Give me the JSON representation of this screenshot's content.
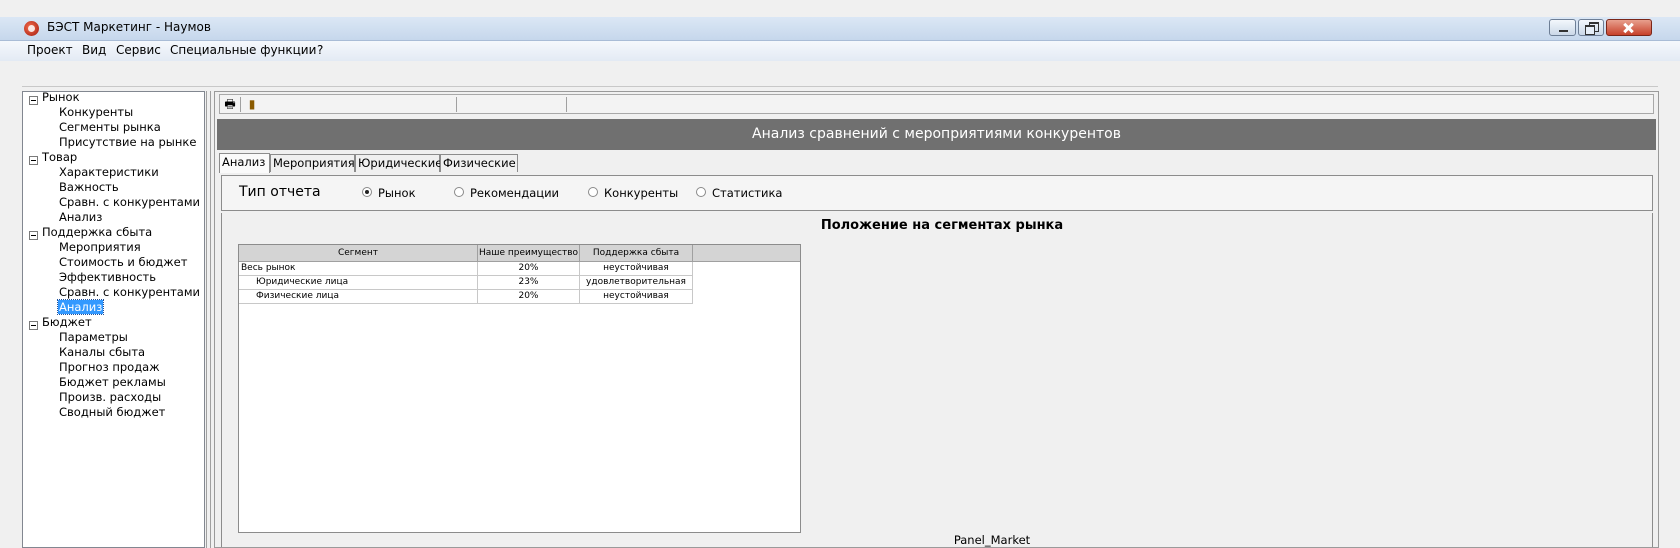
{
  "window": {
    "title": "БЭСТ Маркетинг - Наумов"
  },
  "menu": [
    "Проект",
    "Вид",
    "Сервис",
    "Специальные функции",
    "?"
  ],
  "tree": [
    {
      "label": "Рынок",
      "expanded": true,
      "children": [
        "Конкуренты",
        "Сегменты рынка",
        "Присутствие на рынке"
      ]
    },
    {
      "label": "Товар",
      "expanded": true,
      "children": [
        "Характеристики",
        "Важность",
        "Сравн. с конкурентами",
        "Анализ"
      ]
    },
    {
      "label": "Поддержка сбыта",
      "expanded": true,
      "children": [
        "Мероприятия",
        "Стоимость и бюджет",
        "Эффективность",
        "Сравн. с конкурентами",
        "Анализ"
      ],
      "selected_child": 4
    },
    {
      "label": "Бюджет",
      "expanded": true,
      "children": [
        "Параметры",
        "Каналы сбыта",
        "Прогноз продаж",
        "Бюджет рекламы",
        "Произв. расходы",
        "Сводный бюджет"
      ]
    }
  ],
  "toolbar": {
    "print_icon": "printer-icon",
    "chart_icon": "bar-chart-icon"
  },
  "banner": "Анализ сравнений с мероприятиями конкурентов",
  "tabs": [
    "Анализ",
    "Мероприятия",
    "Юридические",
    "Физические"
  ],
  "active_tab": 0,
  "report_type": {
    "label": "Тип отчета",
    "options": [
      "Рынок",
      "Рекомендации",
      "Конкуренты",
      "Статистика"
    ],
    "selected": 0
  },
  "content": {
    "title": "Положение на сегментах рынка",
    "table": {
      "headers": [
        "Сегмент",
        "Наше преимущество",
        "Поддержка сбыта"
      ],
      "rows": [
        {
          "segment": "Весь рынок",
          "advantage": "20%",
          "support": "неустойчивая"
        },
        {
          "segment": "Юридические лица",
          "advantage": "23%",
          "support": "удовлетворительная"
        },
        {
          "segment": "Физические лица",
          "advantage": "20%",
          "support": "неустойчивая"
        }
      ]
    },
    "panel_caption": "Panel_Market"
  },
  "colors": {
    "banner_bg": "#707070",
    "selection": "#3399ff"
  }
}
